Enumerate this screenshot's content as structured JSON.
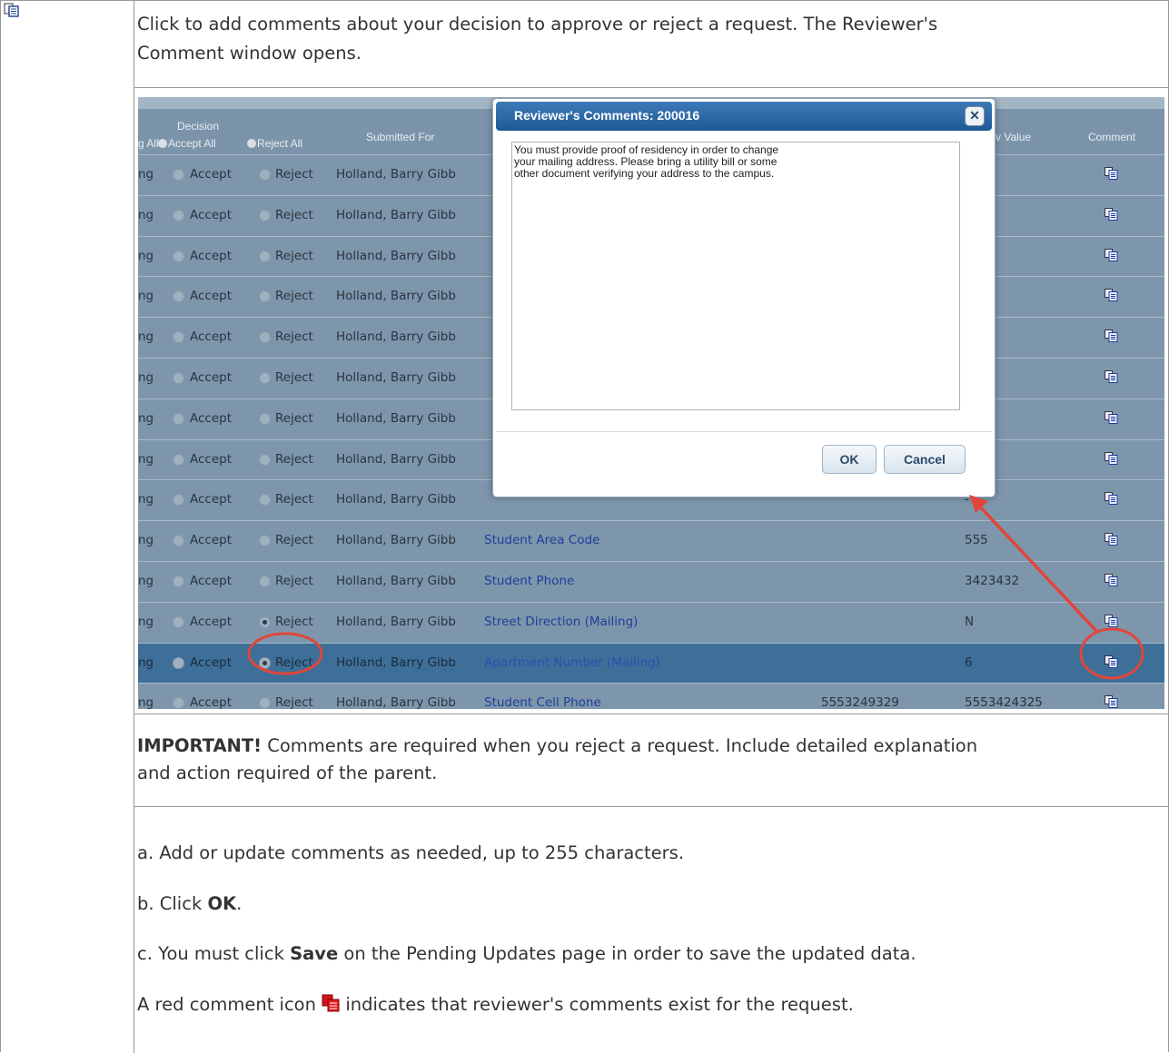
{
  "intro": {
    "line1": "Click to add comments about your decision to approve or reject a request. The Reviewer's",
    "line2": "Comment window opens."
  },
  "table": {
    "headers": {
      "decision": "Decision",
      "pending_all_fragment": "g All",
      "accept_all": "Accept All",
      "reject_all": "Reject All",
      "submitted_for": "Submitted For",
      "new_value_fragment": "v Value",
      "comment": "Comment"
    },
    "rows": [
      {
        "status": "ng",
        "accept": "Accept",
        "reject": "Reject",
        "name": "Holland, Barry Gibb",
        "field": "",
        "old": "",
        "new": "-",
        "selected": "none"
      },
      {
        "status": "ng",
        "accept": "Accept",
        "reject": "Reject",
        "name": "Holland, Barry Gibb",
        "field": "",
        "old": "",
        "new": "-",
        "selected": "none"
      },
      {
        "status": "ng",
        "accept": "Accept",
        "reject": "Reject",
        "name": "Holland, Barry Gibb",
        "field": "",
        "old": "",
        "new": "-",
        "selected": "none"
      },
      {
        "status": "ng",
        "accept": "Accept",
        "reject": "Reject",
        "name": "Holland, Barry Gibb",
        "field": "",
        "old": "",
        "new": "-",
        "selected": "none"
      },
      {
        "status": "ng",
        "accept": "Accept",
        "reject": "Reject",
        "name": "Holland, Barry Gibb",
        "field": "",
        "old": "",
        "new": "-",
        "selected": "none"
      },
      {
        "status": "ng",
        "accept": "Accept",
        "reject": "Reject",
        "name": "Holland, Barry Gibb",
        "field": "",
        "old": "",
        "new": "-",
        "selected": "none"
      },
      {
        "status": "ng",
        "accept": "Accept",
        "reject": "Reject",
        "name": "Holland, Barry Gibb",
        "field": "",
        "old": "",
        "new": "-",
        "selected": "none"
      },
      {
        "status": "ng",
        "accept": "Accept",
        "reject": "Reject",
        "name": "Holland, Barry Gibb",
        "field": "",
        "old": "",
        "new": "-",
        "selected": "none"
      },
      {
        "status": "ng",
        "accept": "Accept",
        "reject": "Reject",
        "name": "Holland, Barry Gibb",
        "field": "",
        "old": "",
        "new": "-",
        "selected": "none"
      },
      {
        "status": "ng",
        "accept": "Accept",
        "reject": "Reject",
        "name": "Holland, Barry Gibb",
        "field": "Student Area Code",
        "old": "",
        "new": "555",
        "selected": "none"
      },
      {
        "status": "ng",
        "accept": "Accept",
        "reject": "Reject",
        "name": "Holland, Barry Gibb",
        "field": "Student Phone",
        "old": "",
        "new": "3423432",
        "selected": "none"
      },
      {
        "status": "ng",
        "accept": "Accept",
        "reject": "Reject",
        "name": "Holland, Barry Gibb",
        "field": "Street Direction (Mailing)",
        "old": "",
        "new": "N",
        "selected": "reject"
      },
      {
        "status": "ng",
        "accept": "Accept",
        "reject": "Reject",
        "name": "Holland, Barry Gibb",
        "field": "Apartment Number (Mailing)",
        "old": "",
        "new": "6",
        "selected": "reject"
      },
      {
        "status": "ng",
        "accept": "Accept",
        "reject": "Reject",
        "name": "Holland, Barry Gibb",
        "field": "Student Cell Phone",
        "old": "5553249329",
        "new": "5553424325",
        "selected": "none"
      }
    ],
    "highlighted_row": 12
  },
  "dialog": {
    "title": "Reviewer's Comments: 200016",
    "close_symbol": "✕",
    "comment_text": "You must provide proof of residency in order to change\nyour mailing address. Please bring a utility bill or some\nother document verifying your address to the campus.",
    "ok_label": "OK",
    "cancel_label": "Cancel"
  },
  "important": {
    "bold": "IMPORTANT!",
    "rest": " Comments are required when you reject a request. Include detailed explanation",
    "line2": "and action required of the parent."
  },
  "steps": {
    "a": "a. Add or update comments as needed, up to 255 characters.",
    "b_prefix": "b. Click ",
    "b_bold": "OK",
    "b_suffix": ".",
    "c_prefix": "c. You must click ",
    "c_bold": "Save",
    "c_suffix": " on the Pending Updates page in order to save the updated data."
  },
  "red_note": {
    "prefix": "A red comment icon ",
    "suffix": " indicates that reviewer's comments exist for the request."
  },
  "colors": {
    "annotation": "#e0463a",
    "grid_bg": "#7e96ab",
    "dialog_title": "#1d5a98",
    "red_icon": "#d4141a"
  },
  "icons": [
    "comment-icon",
    "red-comment-icon",
    "close-icon",
    "arrow-annotation"
  ]
}
